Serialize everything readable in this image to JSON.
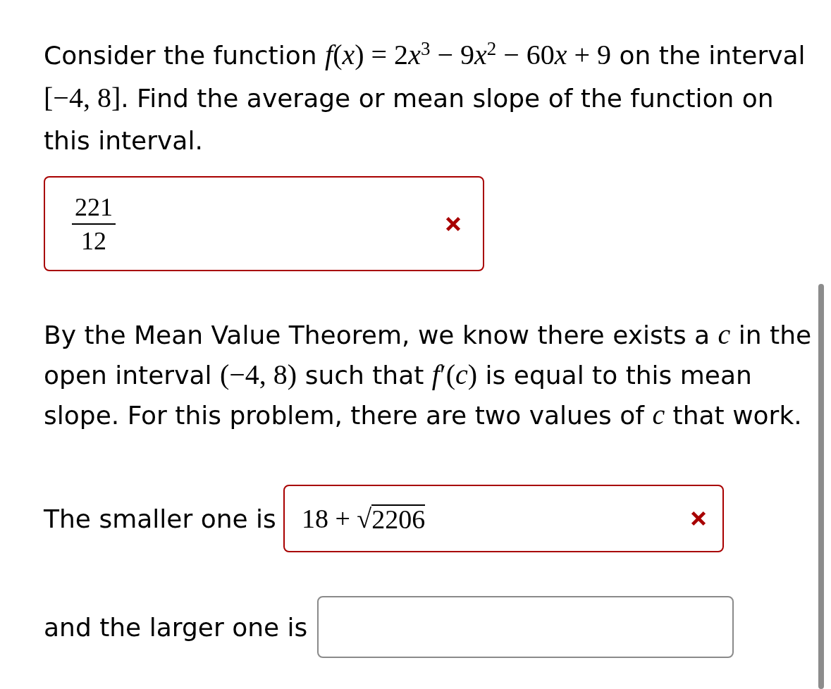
{
  "intro": [
    {
      "kind": "text",
      "text": "Consider the function "
    },
    {
      "kind": "var",
      "text": "f"
    },
    {
      "kind": "math",
      "text": "("
    },
    {
      "kind": "var",
      "text": "x"
    },
    {
      "kind": "math",
      "text": ") = 2"
    },
    {
      "kind": "var",
      "text": "x"
    },
    {
      "kind": "sup",
      "text": "3"
    },
    {
      "kind": "math",
      "text": " − 9"
    },
    {
      "kind": "var",
      "text": "x"
    },
    {
      "kind": "sup",
      "text": "2"
    },
    {
      "kind": "math",
      "text": " − 60"
    },
    {
      "kind": "var",
      "text": "x"
    },
    {
      "kind": "math",
      "text": " + 9"
    },
    {
      "kind": "text",
      "text": " on the interval "
    },
    {
      "kind": "math",
      "text": "[−4, 8]"
    },
    {
      "kind": "text",
      "text": ". Find the average or mean slope of the function on this interval."
    }
  ],
  "answer_1": {
    "kind": "fraction",
    "numerator": "221",
    "denominator": "12",
    "incorrect": true
  },
  "theorem": [
    {
      "kind": "text",
      "text": "By the Mean Value Theorem, we know there exists a "
    },
    {
      "kind": "var",
      "text": "c"
    },
    {
      "kind": "text",
      "text": " in the open interval "
    },
    {
      "kind": "math",
      "text": "(−4, 8)"
    },
    {
      "kind": "text",
      "text": " such that "
    },
    {
      "kind": "var",
      "text": "f"
    },
    {
      "kind": "math",
      "text": "′("
    },
    {
      "kind": "var",
      "text": "c"
    },
    {
      "kind": "math",
      "text": ")"
    },
    {
      "kind": "text",
      "text": " is equal to this mean slope. For this problem, there are two values of "
    },
    {
      "kind": "var",
      "text": "c"
    },
    {
      "kind": "text",
      "text": " that work."
    }
  ],
  "answers": [
    {
      "label": "The smaller one is",
      "kind": "sqrt",
      "before": "18 + √",
      "radicand": "2206",
      "incorrect": true
    },
    {
      "label": "and the larger one is",
      "kind": "empty",
      "incorrect": false
    }
  ]
}
